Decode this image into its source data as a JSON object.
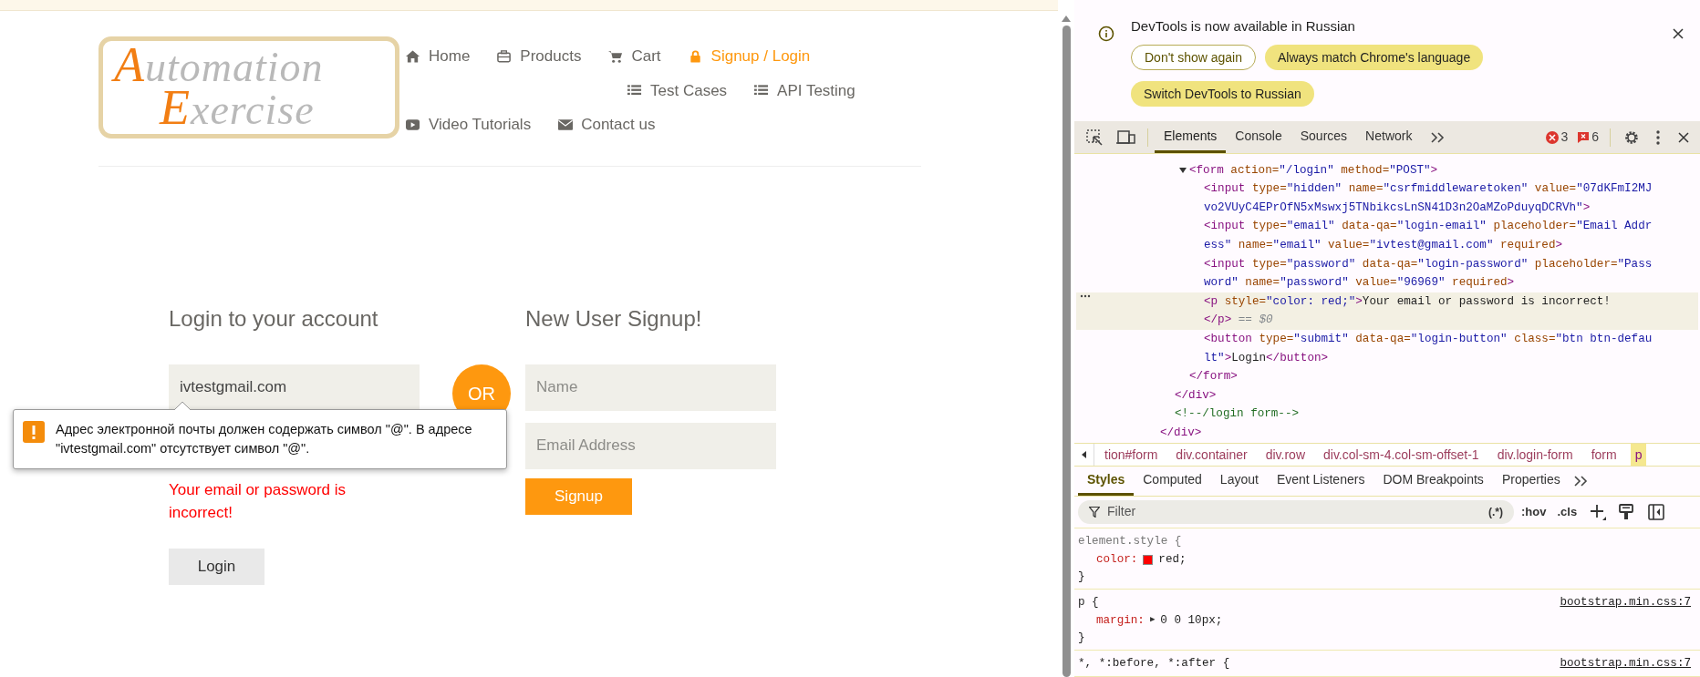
{
  "site": {
    "logo": {
      "lines": [
        {
          "initial": "A",
          "rest": "utomation"
        },
        {
          "initial": "E",
          "rest": "xercise"
        }
      ]
    },
    "nav": {
      "items": [
        {
          "kind": "home",
          "label": "Home",
          "selected": false
        },
        {
          "kind": "briefcase",
          "label": "Products",
          "selected": false
        },
        {
          "kind": "cart",
          "label": "Cart",
          "selected": false
        },
        {
          "kind": "lock",
          "label": "Signup / Login",
          "selected": true
        },
        {
          "kind": "list",
          "label": "Test Cases",
          "selected": false
        },
        {
          "kind": "list",
          "label": "API Testing",
          "selected": false
        },
        {
          "kind": "video",
          "label": "Video Tutorials",
          "selected": false
        },
        {
          "kind": "envelope",
          "label": "Contact us",
          "selected": false
        }
      ]
    },
    "login": {
      "title": "Login to your account",
      "email": {
        "value": "ivtestgmail.com"
      },
      "error": "Your email or password is incorrect!",
      "button": "Login"
    },
    "or": "OR",
    "signup": {
      "title": "New User Signup!",
      "name": {
        "placeholder": "Name"
      },
      "email": {
        "placeholder": "Email Address"
      },
      "button": "Signup"
    },
    "validation_tooltip": {
      "text": "Адрес электронной почты должен содержать символ \"@\". В адресе \"ivtestgmail.com\" отсутствует символ \"@\"."
    }
  },
  "devtools": {
    "infobar": {
      "message": "DevTools is now available in Russian",
      "buttons": [
        {
          "label": "Don't show again",
          "kind": "outline"
        },
        {
          "label": "Always match Chrome's language",
          "kind": "filled"
        },
        {
          "label": "Switch DevTools to Russian",
          "kind": "filled"
        }
      ]
    },
    "tabs": [
      {
        "label": "Elements",
        "selected": true
      },
      {
        "label": "Console",
        "selected": false
      },
      {
        "label": "Sources",
        "selected": false
      },
      {
        "label": "Network",
        "selected": false
      }
    ],
    "errors": "3",
    "issues": "6",
    "dom_tree": [
      {
        "selected": false,
        "close": [
          [
            {
              "kind": "tag",
              "text": "</div>"
            }
          ]
        ],
        "children": [
          {
            "selected": false,
            "close": [
              [
                {
                  "kind": "tag",
                  "text": "</div>"
                }
              ]
            ],
            "children": [
              {
                "selected": false,
                "expanded": true,
                "lines": [
                  [
                    {
                      "kind": "tag",
                      "text": "<form"
                    },
                    {
                      "kind": "attr",
                      "text": " action="
                    },
                    {
                      "kind": "val",
                      "text": "\"/login\""
                    },
                    {
                      "kind": "attr",
                      "text": " method="
                    },
                    {
                      "kind": "val",
                      "text": "\"POST\""
                    },
                    {
                      "kind": "tag",
                      "text": ">"
                    }
                  ]
                ],
                "close": [
                  [
                    {
                      "kind": "tag",
                      "text": "</form>"
                    }
                  ]
                ],
                "children": [
                  {
                    "selected": false,
                    "lines": [
                      [
                        {
                          "kind": "tag",
                          "text": "<input"
                        },
                        {
                          "kind": "attr",
                          "text": " type="
                        },
                        {
                          "kind": "val",
                          "text": "\"hidden\""
                        },
                        {
                          "kind": "attr",
                          "text": " name="
                        },
                        {
                          "kind": "val",
                          "text": "\"csrfmiddlewaretoken\""
                        },
                        {
                          "kind": "attr",
                          "text": " value="
                        },
                        {
                          "kind": "val",
                          "text": "\"07dKFmI2MJ"
                        }
                      ],
                      [
                        {
                          "kind": "val",
                          "text": "vo2VUyC4EPrOfN5xMswxj5TNbikcsLnSN41D3n2OaMZoPduyqDCRVh\""
                        },
                        {
                          "kind": "tag",
                          "text": ">"
                        }
                      ]
                    ]
                  },
                  {
                    "selected": false,
                    "lines": [
                      [
                        {
                          "kind": "tag",
                          "text": "<input"
                        },
                        {
                          "kind": "attr",
                          "text": " type="
                        },
                        {
                          "kind": "val",
                          "text": "\"email\""
                        },
                        {
                          "kind": "attr",
                          "text": " data-qa="
                        },
                        {
                          "kind": "val",
                          "text": "\"login-email\""
                        },
                        {
                          "kind": "attr",
                          "text": " placeholder="
                        },
                        {
                          "kind": "val",
                          "text": "\"Email Addr"
                        }
                      ],
                      [
                        {
                          "kind": "val",
                          "text": "ess\""
                        },
                        {
                          "kind": "attr",
                          "text": " name="
                        },
                        {
                          "kind": "val",
                          "text": "\"email\""
                        },
                        {
                          "kind": "attr",
                          "text": " value="
                        },
                        {
                          "kind": "val",
                          "text": "\"ivtest@gmail.com\""
                        },
                        {
                          "kind": "attr",
                          "text": " required"
                        },
                        {
                          "kind": "tag",
                          "text": ">"
                        }
                      ]
                    ]
                  },
                  {
                    "selected": false,
                    "lines": [
                      [
                        {
                          "kind": "tag",
                          "text": "<input"
                        },
                        {
                          "kind": "attr",
                          "text": " type="
                        },
                        {
                          "kind": "val",
                          "text": "\"password\""
                        },
                        {
                          "kind": "attr",
                          "text": " data-qa="
                        },
                        {
                          "kind": "val",
                          "text": "\"login-password\""
                        },
                        {
                          "kind": "attr",
                          "text": " placeholder="
                        },
                        {
                          "kind": "val",
                          "text": "\"Pass"
                        }
                      ],
                      [
                        {
                          "kind": "val",
                          "text": "word\""
                        },
                        {
                          "kind": "attr",
                          "text": " name="
                        },
                        {
                          "kind": "val",
                          "text": "\"password\""
                        },
                        {
                          "kind": "attr",
                          "text": " value="
                        },
                        {
                          "kind": "val",
                          "text": "\"96969\""
                        },
                        {
                          "kind": "attr",
                          "text": " required"
                        },
                        {
                          "kind": "tag",
                          "text": ">"
                        }
                      ]
                    ]
                  },
                  {
                    "selected": true,
                    "lines": [
                      [
                        {
                          "kind": "tag",
                          "text": "<p"
                        },
                        {
                          "kind": "attr",
                          "text": " style="
                        },
                        {
                          "kind": "val",
                          "text": "\"color: red;\""
                        },
                        {
                          "kind": "tag",
                          "text": ">"
                        },
                        {
                          "kind": "text",
                          "text": "Your email or password is incorrect!"
                        }
                      ],
                      [
                        {
                          "kind": "tag",
                          "text": "</p>"
                        },
                        {
                          "kind": "eq",
                          "text": " == $0"
                        }
                      ]
                    ]
                  },
                  {
                    "selected": false,
                    "lines": [
                      [
                        {
                          "kind": "tag",
                          "text": "<button"
                        },
                        {
                          "kind": "attr",
                          "text": " type="
                        },
                        {
                          "kind": "val",
                          "text": "\"submit\""
                        },
                        {
                          "kind": "attr",
                          "text": " data-qa="
                        },
                        {
                          "kind": "val",
                          "text": "\"login-button\""
                        },
                        {
                          "kind": "attr",
                          "text": " class="
                        },
                        {
                          "kind": "val",
                          "text": "\"btn btn-defau"
                        }
                      ],
                      [
                        {
                          "kind": "val",
                          "text": "lt\""
                        },
                        {
                          "kind": "tag",
                          "text": ">"
                        },
                        {
                          "kind": "text",
                          "text": "Login"
                        },
                        {
                          "kind": "tag",
                          "text": "</button>"
                        }
                      ]
                    ]
                  }
                ]
              }
            ]
          },
          {
            "selected": false,
            "lines": [
              [
                {
                  "kind": "comment",
                  "text": "<!--/login form-->"
                }
              ]
            ]
          }
        ]
      }
    ],
    "breadcrumbs": [
      {
        "label": "tion#form",
        "selected": false
      },
      {
        "label": "div.container",
        "selected": false
      },
      {
        "label": "div.row",
        "selected": false
      },
      {
        "label": "div.col-sm-4.col-sm-offset-1",
        "selected": false
      },
      {
        "label": "div.login-form",
        "selected": false
      },
      {
        "label": "form",
        "selected": false
      },
      {
        "label": "p",
        "selected": true
      }
    ],
    "styles_tabs": [
      {
        "label": "Styles",
        "selected": true
      },
      {
        "label": "Computed",
        "selected": false
      },
      {
        "label": "Layout",
        "selected": false
      },
      {
        "label": "Event Listeners",
        "selected": false
      },
      {
        "label": "DOM Breakpoints",
        "selected": false
      },
      {
        "label": "Properties",
        "selected": false
      }
    ],
    "filter": {
      "placeholder": "Filter",
      "regex": "(.*)",
      "hov": ":hov",
      "cls": ".cls"
    },
    "rules": [
      {
        "kind": "inline",
        "selector": "element.style {",
        "declarations": [
          {
            "property": "color:",
            "value": "red;",
            "color": "#ff0000"
          }
        ],
        "close": "}"
      },
      {
        "kind": "rule",
        "selector": "p {",
        "source": "bootstrap.min.css:7",
        "declarations": [
          {
            "property": "margin:",
            "expander": "▶",
            "value": "0 0 10px;"
          }
        ],
        "close": "}"
      },
      {
        "kind": "rule",
        "selector": "*, *:before, *:after {",
        "source": "bootstrap.min.css:7"
      }
    ]
  }
}
